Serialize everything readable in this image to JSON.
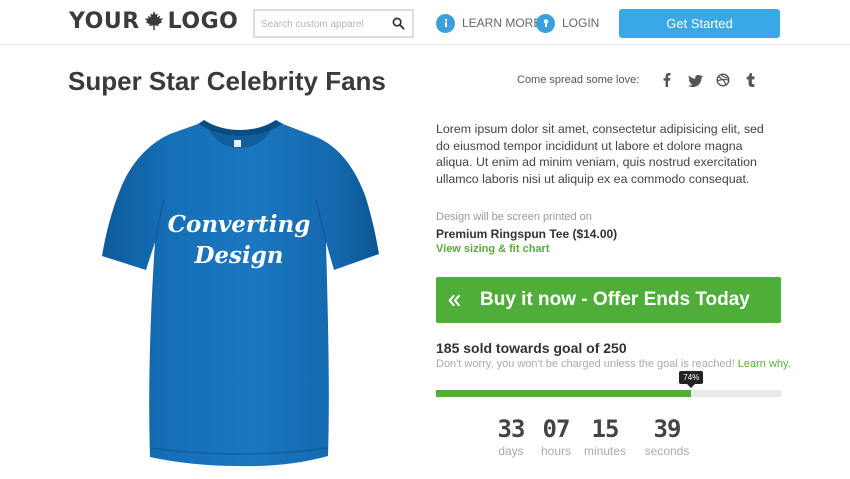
{
  "header": {
    "logo_left": "YOUR",
    "logo_right": "LOGO",
    "search_placeholder": "Search custom apparel",
    "learn_more": "LEARN MORE",
    "login": "LOGIN",
    "get_started": "Get Started"
  },
  "page": {
    "title": "Super Star Celebrity Fans",
    "spread": "Come spread some love:",
    "social_icons": [
      "facebook-icon",
      "twitter-icon",
      "dribbble-icon",
      "tumblr-icon"
    ]
  },
  "shirt": {
    "line1": "Converting",
    "line2": "Design",
    "color": "#1168b0"
  },
  "product": {
    "description": "Lorem ipsum dolor sit amet, consectetur adipisicing elit, sed do eiusmod tempor incididunt ut labore et dolore magna aliqua. Ut enim ad minim veniam, quis nostrud exercitation ullamco laboris nisi ut aliquip ex ea commodo consequat.",
    "print_note": "Design will be screen printed on",
    "name": "Premium Ringspun Tee ($14.00)",
    "sizing": "View sizing & fit chart",
    "buy_label": "Buy it now - Offer Ends Today"
  },
  "campaign": {
    "sold_text": "185 sold towards goal of 250",
    "note": "Don't worry, you won't be charged unless the goal is reached!",
    "learn_why": "Learn why.",
    "progress_fraction": 0.74,
    "progress_label": "74%"
  },
  "countdown": [
    {
      "value": "33",
      "unit": "days"
    },
    {
      "value": "07",
      "unit": "hours"
    },
    {
      "value": "15",
      "unit": "minutes"
    },
    {
      "value": "39",
      "unit": "seconds"
    }
  ],
  "colors": {
    "accent_blue": "#3aa8e4",
    "green": "#4fae3a",
    "shirt_blue": "#1168b0"
  }
}
